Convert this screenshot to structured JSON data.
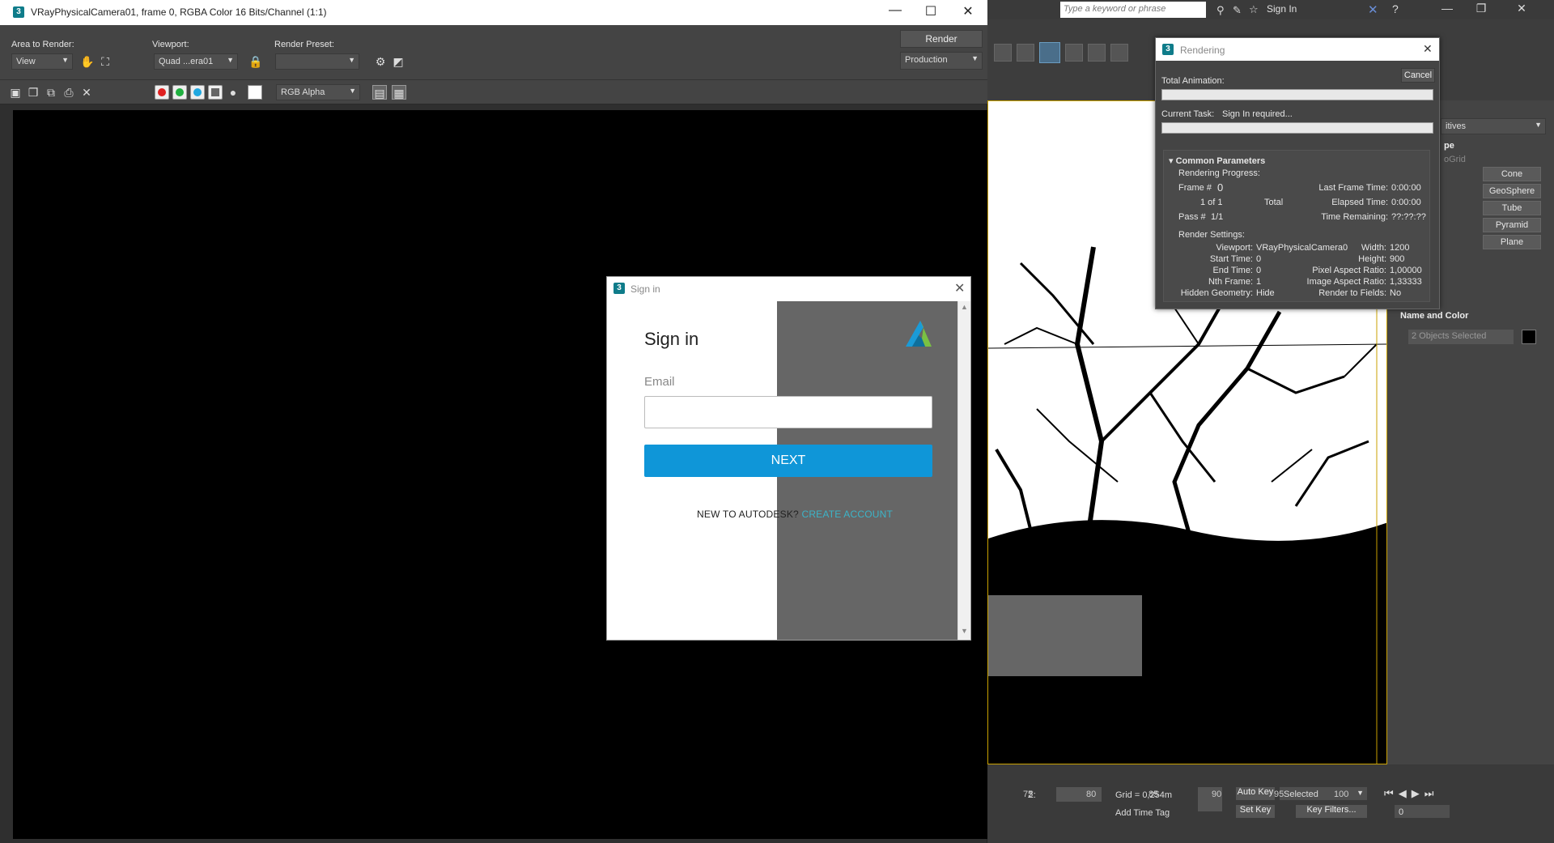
{
  "vfb": {
    "title": "VRayPhysicalCamera01, frame 0, RGBA Color 16 Bits/Channel (1:1)",
    "area_label": "Area to Render:",
    "area_value": "View",
    "viewport_label": "Viewport:",
    "viewport_value": "Quad ...era01",
    "preset_label": "Render Preset:",
    "preset_value": "",
    "render_button": "Render",
    "production_value": "Production",
    "channel_value": "RGB Alpha"
  },
  "signin": {
    "window_title": "Sign in",
    "heading": "Sign in",
    "email_label": "Email",
    "email_value": "",
    "next_label": "NEXT",
    "new_to": "NEW TO AUTODESK?",
    "create_account": "CREATE ACCOUNT"
  },
  "max": {
    "search_placeholder": "Type a keyword or phrase",
    "signin_label": "Sign In",
    "cmd_buttons": [
      "Cone",
      "GeoSphere",
      "Tube",
      "Pyramid",
      "Plane"
    ],
    "dropdown_fragment": "itives",
    "rollout_fragment": "pe",
    "autogrid_fragment": "oGrid",
    "name_color_label": "Name and Color",
    "objects_selected": "2 Objects Selected",
    "ruler": [
      "75",
      "80",
      "85",
      "90",
      "95",
      "100"
    ],
    "z_label": "Z:",
    "grid_value": "Grid = 0,254m",
    "auto_key": "Auto Key",
    "selected_value": "Selected",
    "set_key": "Set Key",
    "key_filters": "Key Filters...",
    "frame_value": "0",
    "add_time_tag": "Add Time Tag"
  },
  "rendering": {
    "title": "Rendering",
    "cancel": "Cancel",
    "total_animation": "Total Animation:",
    "current_task_label": "Current Task:",
    "current_task_value": "Sign In required...",
    "common_params": "Common Parameters",
    "rendering_progress": "Rendering Progress:",
    "frame_label": "Frame #",
    "frame_value": "0",
    "of_value": "1 of 1",
    "total": "Total",
    "pass_label": "Pass #",
    "pass_value": "1/1",
    "last_frame_time": "Last Frame Time:",
    "last_frame_time_value": "0:00:00",
    "elapsed_time": "Elapsed Time:",
    "elapsed_time_value": "0:00:00",
    "time_remaining": "Time Remaining:",
    "time_remaining_value": "??:??:??",
    "render_settings": "Render Settings:",
    "viewport_label": "Viewport:",
    "viewport_value": "VRayPhysicalCamera0",
    "width_label": "Width:",
    "width_value": "1200",
    "start_time_label": "Start Time:",
    "start_time_value": "0",
    "height_label": "Height:",
    "height_value": "900",
    "end_time_label": "End Time:",
    "end_time_value": "0",
    "pixel_aspect_label": "Pixel Aspect Ratio:",
    "pixel_aspect_value": "1,00000",
    "nth_frame_label": "Nth Frame:",
    "nth_frame_value": "1",
    "image_aspect_label": "Image Aspect Ratio:",
    "image_aspect_value": "1,33333",
    "hidden_geometry_label": "Hidden Geometry:",
    "hidden_geometry_value": "Hide",
    "render_fields_label": "Render to Fields:",
    "render_fields_value": "No"
  }
}
